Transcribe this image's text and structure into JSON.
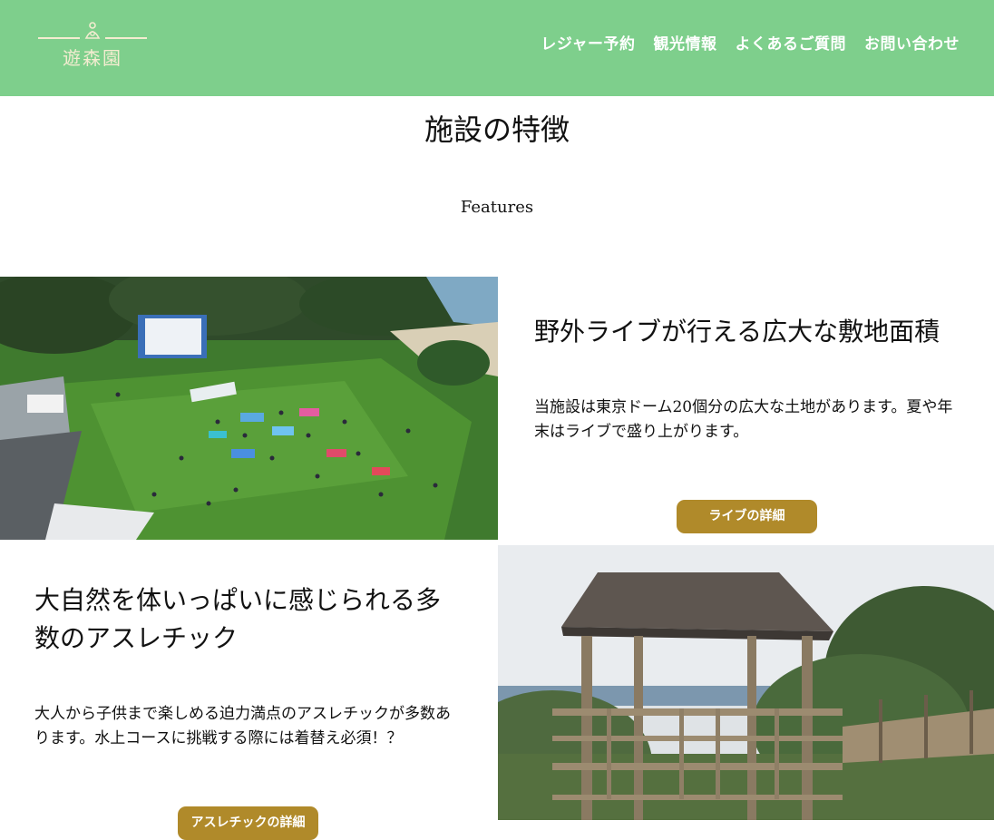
{
  "header": {
    "logo_text": "遊森園",
    "nav": [
      "レジャー予約",
      "観光情報",
      "よくあるご質問",
      "お問い合わせ"
    ]
  },
  "section": {
    "title": "施設の特徴",
    "subtitle": "Features"
  },
  "features": [
    {
      "title": "野外ライブが行える広大な敷地面積",
      "text": "当施設は東京ドーム20個分の広大な土地があります。夏や年末はライブで盛り上がります。",
      "button": "ライブの詳細"
    },
    {
      "title": "大自然を体いっぱいに感じられる多数のアスレチック",
      "text": "大人から子供まで楽しめる迫力満点のアスレチックが多数あります。水上コースに挑戦する際には着替え必須！？",
      "button": "アスレチックの詳細"
    }
  ],
  "colors": {
    "header_bg": "#7ecf8c",
    "button_bg": "#b08a2a",
    "logo_color": "#f3ecd0"
  }
}
